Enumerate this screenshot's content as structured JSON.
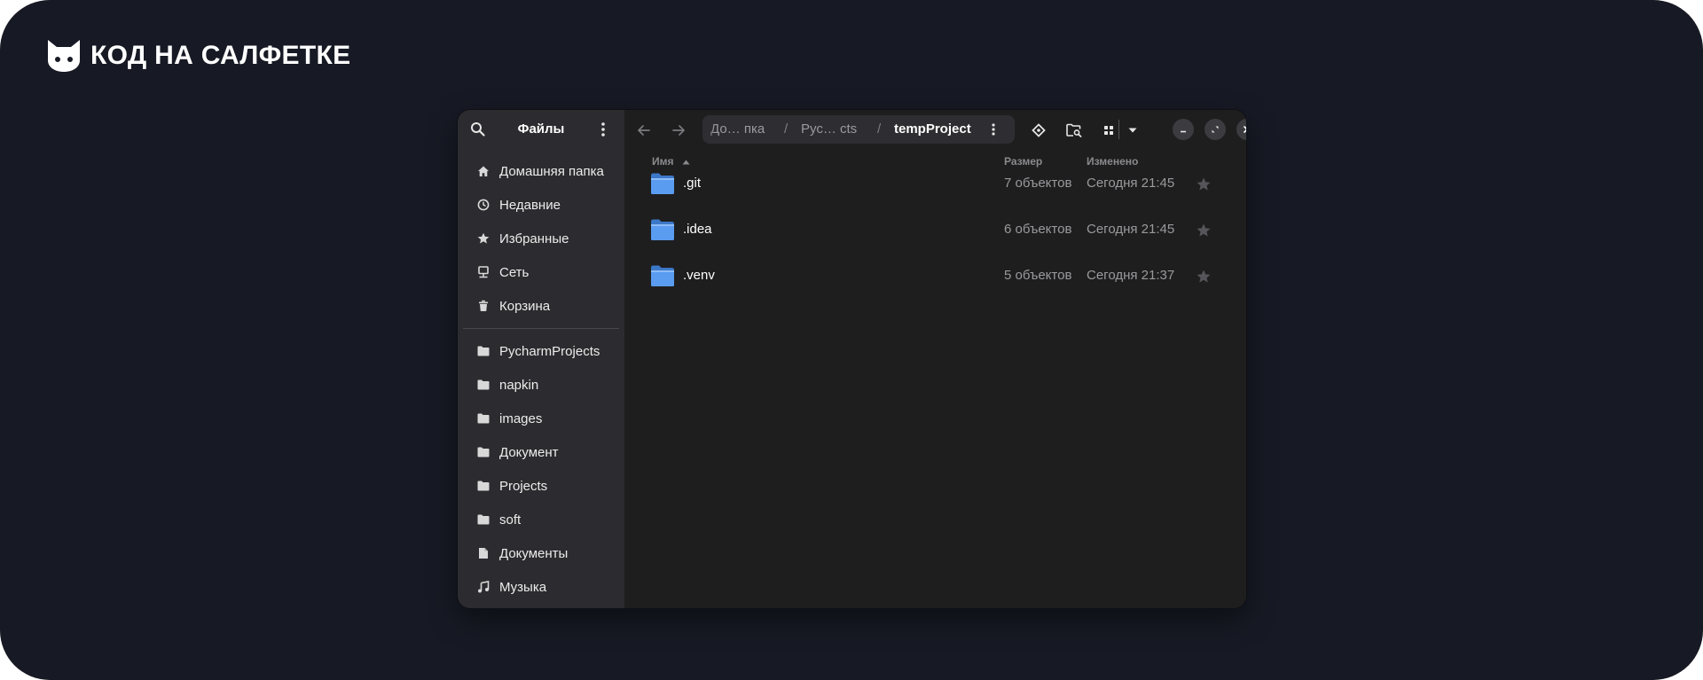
{
  "brand": {
    "name": "КОД НА САЛФЕТКЕ"
  },
  "sidebar": {
    "title": "Файлы",
    "search_icon": "search-icon",
    "menu_icon": "kebab-menu-icon",
    "places": [
      {
        "label": "Домашняя папка",
        "icon": "home-icon"
      },
      {
        "label": "Недавние",
        "icon": "clock-icon"
      },
      {
        "label": "Избранные",
        "icon": "star-icon"
      },
      {
        "label": "Сеть",
        "icon": "network-icon"
      },
      {
        "label": "Корзина",
        "icon": "trash-icon"
      }
    ],
    "bookmarks": [
      {
        "label": "PycharmProjects",
        "icon": "folder-icon"
      },
      {
        "label": "napkin",
        "icon": "folder-icon"
      },
      {
        "label": "images",
        "icon": "folder-icon"
      },
      {
        "label": "Документ",
        "icon": "folder-icon"
      },
      {
        "label": "Projects",
        "icon": "folder-icon"
      },
      {
        "label": "soft",
        "icon": "folder-icon"
      },
      {
        "label": "Документы",
        "icon": "document-icon"
      },
      {
        "label": "Музыка",
        "icon": "music-icon"
      }
    ]
  },
  "headerbar": {
    "path": [
      {
        "label": "До…  пка"
      },
      {
        "label": "Рус…  cts"
      },
      {
        "label": "tempProject",
        "current": true
      }
    ],
    "path_separator": "/",
    "icons": [
      "back-arrow-icon",
      "forward-arrow-icon",
      "kebab-menu-icon",
      "location-icon",
      "folder-search-icon",
      "grid-view-icon",
      "dropdown-icon",
      "minimize-icon",
      "restore-icon",
      "close-icon"
    ]
  },
  "columns": {
    "name": "Имя",
    "size": "Размер",
    "modified": "Изменено"
  },
  "files": [
    {
      "name": ".git",
      "size": "7 объектов",
      "modified": "Сегодня 21:45"
    },
    {
      "name": ".idea",
      "size": "6 объектов",
      "modified": "Сегодня 21:45"
    },
    {
      "name": ".venv",
      "size": "5 объектов",
      "modified": "Сегодня 21:37"
    }
  ],
  "colors": {
    "background": "#171a24",
    "sidebar": "#2c2c30",
    "content": "#1e1e1e",
    "folder": "#4f8fe0"
  }
}
